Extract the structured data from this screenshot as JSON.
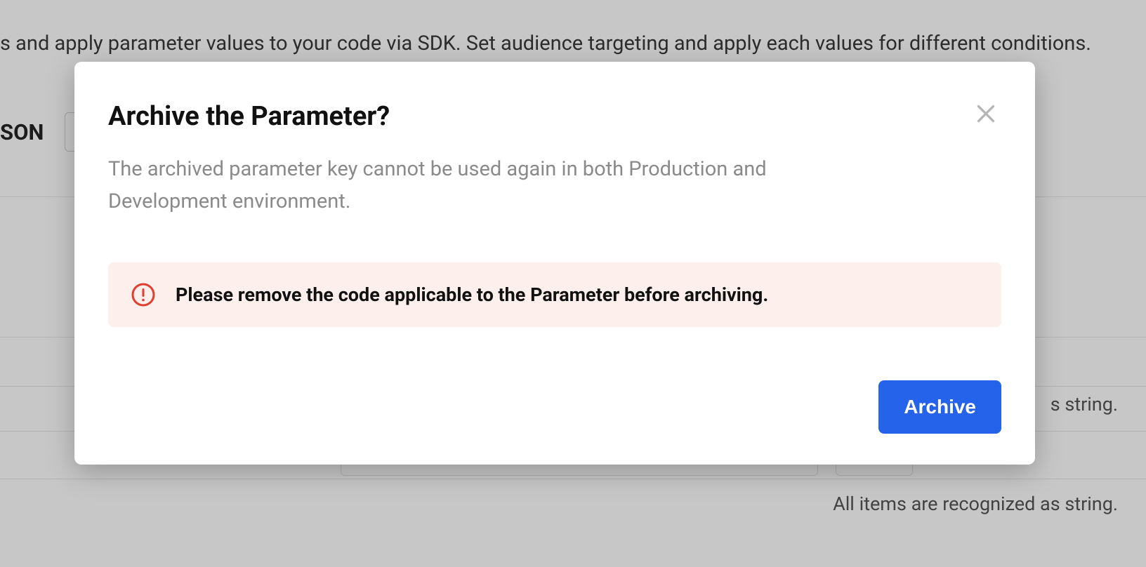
{
  "background": {
    "intro_text": "s and apply parameter values to your code via SDK. Set audience targeting and apply each values for different conditions.",
    "son_label": "SON",
    "string_hint_1": "s string.",
    "string_hint_2": "All items are recognized as string."
  },
  "modal": {
    "title": "Archive the Parameter?",
    "description": "The archived parameter key cannot be used again in both Production and Development environment.",
    "warning": "Please remove the code applicable to the Parameter before archiving.",
    "archive_button": "Archive"
  }
}
